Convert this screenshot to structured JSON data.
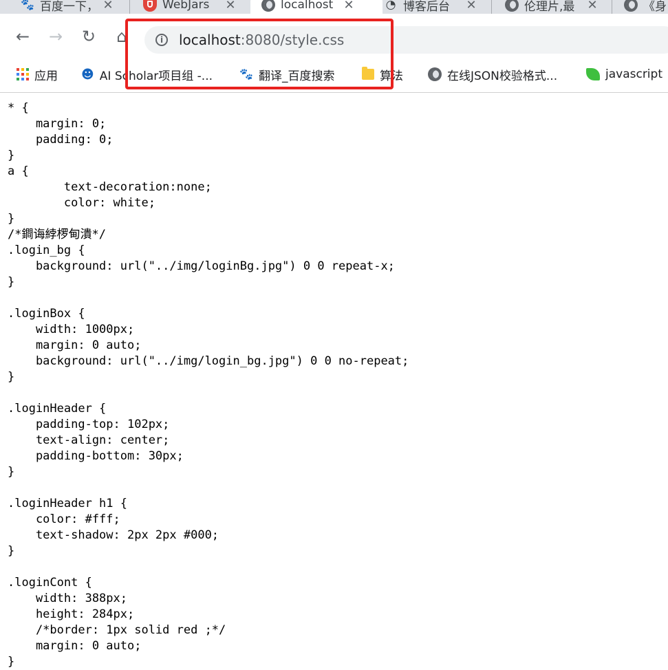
{
  "tabs": [
    {
      "title": "百度一下，",
      "icon": "baidu-paw-icon",
      "active": false
    },
    {
      "title": "WebJars",
      "icon": "webjars-shield-icon",
      "active": false
    },
    {
      "title": "localhost",
      "icon": "globe-icon",
      "active": true
    },
    {
      "title": "博客后台",
      "icon": "github-cat-icon",
      "active": false
    },
    {
      "title": "伦理片,最",
      "icon": "globe-icon",
      "active": false
    },
    {
      "title": "《身",
      "icon": "globe-icon",
      "active": false
    }
  ],
  "tab_close_glyph": "✕",
  "address_bar": {
    "host": "localhost",
    "path": ":8080/style.css"
  },
  "bookmarks": [
    {
      "label": "应用",
      "icon": "apps-grid-icon"
    },
    {
      "label": "AI Scholar项目组 -...",
      "icon": "mascot-icon"
    },
    {
      "label": "翻译_百度搜索",
      "icon": "baidu-paw-icon"
    },
    {
      "label": "算法",
      "icon": "folder-icon"
    },
    {
      "label": "在线JSON校验格式...",
      "icon": "globe-icon"
    },
    {
      "label": "javascript",
      "icon": "leaf-icon"
    }
  ],
  "page": {
    "source_text": "* {\n    margin: 0;\n    padding: 0;\n}\na {\n        text-decoration:none;\n        color: white;\n}\n/*鐧诲綍椤甸潰*/\n.login_bg {\n    background: url(\"../img/loginBg.jpg\") 0 0 repeat-x;\n}\n\n.loginBox {\n    width: 1000px;\n    margin: 0 auto;\n    background: url(\"../img/login_bg.jpg\") 0 0 no-repeat;\n}\n\n.loginHeader {\n    padding-top: 102px;\n    text-align: center;\n    padding-bottom: 30px;\n}\n\n.loginHeader h1 {\n    color: #fff;\n    text-shadow: 2px 2px #000;\n}\n\n.loginCont {\n    width: 388px;\n    height: 284px;\n    /*border: 1px solid red ;*/\n    margin: 0 auto;\n}"
  },
  "colors": {
    "highlight": "#e8221f",
    "tabstrip": "#dee1e6",
    "omnibox": "#f1f3f4"
  }
}
